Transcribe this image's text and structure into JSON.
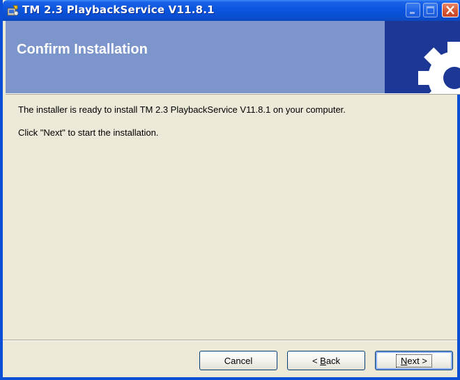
{
  "window": {
    "title": "TM 2.3 PlaybackService V11.8.1",
    "icon": "installer-icon"
  },
  "titlebar_buttons": {
    "minimize_icon": "minimize-icon",
    "maximize_icon": "maximize-icon",
    "close_icon": "close-icon"
  },
  "banner": {
    "title": "Confirm Installation",
    "art_icon": "gear-icon"
  },
  "content": {
    "line1": "The installer is ready to install TM 2.3 PlaybackService V11.8.1 on your computer.",
    "line2": "Click \"Next\" to start the installation."
  },
  "footer": {
    "cancel_label": "Cancel",
    "back_prefix": "< ",
    "back_mnemonic": "B",
    "back_rest": "ack",
    "next_mnemonic": "N",
    "next_rest": "ext >"
  },
  "colors": {
    "titlebar": "#0b55de",
    "banner": "#7c95cb",
    "banner_art": "#1d3797",
    "close_button": "#d3552f",
    "dialog_background": "#ece9d8"
  }
}
